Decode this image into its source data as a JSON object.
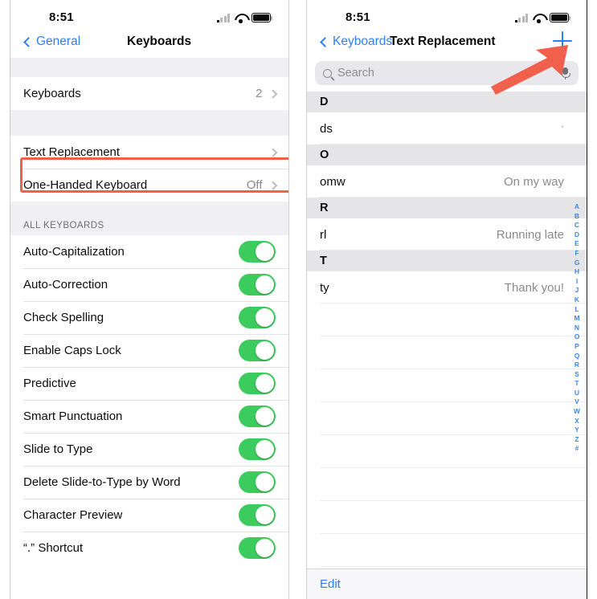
{
  "left_panel": {
    "status": {
      "time": "8:51",
      "cellular_icon": "cellular-bars-icon",
      "wifi_icon": "wifi-icon",
      "battery_icon": "battery-icon"
    },
    "nav": {
      "back_label": "General",
      "title": "Keyboards",
      "back_icon": "chevron-left-icon"
    },
    "keyboards_row": {
      "label": "Keyboards",
      "value": "2",
      "chevron": "chevron-right-icon"
    },
    "text_replacement_row": {
      "label": "Text Replacement",
      "value": "",
      "chevron": "chevron-right-icon"
    },
    "one_handed_row": {
      "label": "One-Handed Keyboard",
      "value": "Off",
      "chevron": "chevron-right-icon"
    },
    "section_header": "ALL KEYBOARDS",
    "toggles": [
      {
        "label": "Auto-Capitalization",
        "on": true
      },
      {
        "label": "Auto-Correction",
        "on": true
      },
      {
        "label": "Check Spelling",
        "on": true
      },
      {
        "label": "Enable Caps Lock",
        "on": true
      },
      {
        "label": "Predictive",
        "on": true
      },
      {
        "label": "Smart Punctuation",
        "on": true
      },
      {
        "label": "Slide to Type",
        "on": true
      },
      {
        "label": "Delete Slide-to-Type by Word",
        "on": true
      },
      {
        "label": "Character Preview",
        "on": true
      },
      {
        "label": "“.” Shortcut",
        "on": true
      }
    ],
    "highlight_color": "#f0604d"
  },
  "right_panel": {
    "status": {
      "time": "8:51",
      "cellular_icon": "cellular-bars-icon",
      "wifi_icon": "wifi-icon",
      "battery_icon": "battery-icon"
    },
    "nav": {
      "back_label": "Keyboards",
      "title": "Text Replacement",
      "add_icon": "plus-icon",
      "back_icon": "chevron-left-icon"
    },
    "search": {
      "placeholder": "Search",
      "value": "",
      "search_icon": "search-icon",
      "mic_icon": "microphone-icon"
    },
    "sections": [
      {
        "letter": "D",
        "entries": [
          {
            "shortcut": "ds",
            "phrase": "°",
            "tiny": true
          }
        ]
      },
      {
        "letter": "O",
        "entries": [
          {
            "shortcut": "omw",
            "phrase": "On my way",
            "tiny": false
          }
        ]
      },
      {
        "letter": "R",
        "entries": [
          {
            "shortcut": "rl",
            "phrase": "Running late",
            "tiny": false
          }
        ]
      },
      {
        "letter": "T",
        "entries": [
          {
            "shortcut": "ty",
            "phrase": "Thank you!",
            "tiny": false
          }
        ]
      }
    ],
    "index_letters": [
      "A",
      "B",
      "C",
      "D",
      "E",
      "F",
      "G",
      "H",
      "I",
      "J",
      "K",
      "L",
      "M",
      "N",
      "O",
      "P",
      "Q",
      "R",
      "S",
      "T",
      "U",
      "V",
      "W",
      "X",
      "Y",
      "Z",
      "#"
    ],
    "edit_label": "Edit",
    "accent_color": "#2f7ff0"
  },
  "annotation": {
    "arrow_color": "#f0604d",
    "arrow_name": "red-arrow-pointing-to-add-button"
  }
}
